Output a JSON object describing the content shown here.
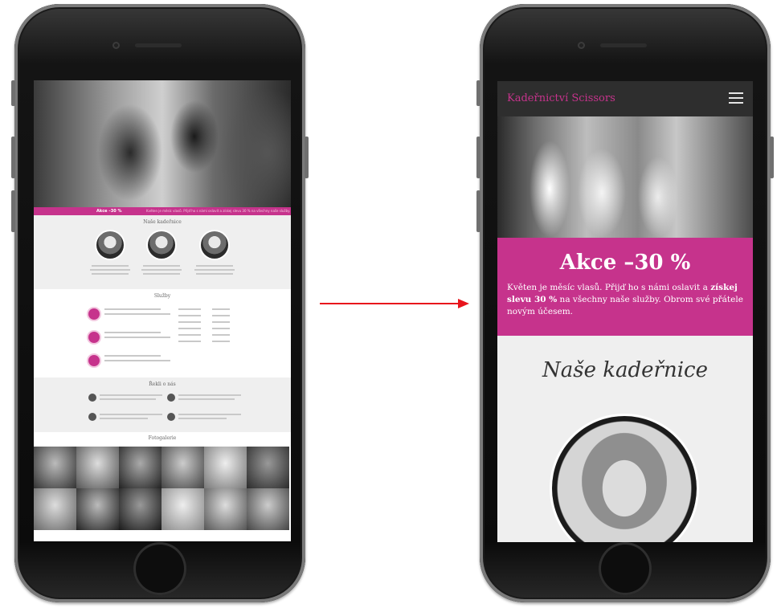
{
  "left_phone": {
    "promo_band": {
      "title": "Akce –30 %",
      "text": "Květen je měsíc vlasů. Přijď ho s námi oslavit a získej slevu 30 % na všechny naše služby."
    },
    "sections": {
      "team_title": "Naše kadeřnice",
      "services_title": "Služby",
      "reviews_title": "Řekli o nás",
      "gallery_title": "Fotogalerie"
    }
  },
  "right_phone": {
    "nav": {
      "brand": "Kadeřnictví Scissors",
      "menu_icon": "hamburger-icon"
    },
    "promo": {
      "title": "Akce –30 %",
      "text_1": "Květen je měsíc vlasů. Přijď ho s námi oslavit a ",
      "text_bold": "získej slevu 30 %",
      "text_2": " na všechny naše služby. Obrom své přátele novým účesem."
    },
    "team": {
      "title": "Naše kadeřnice"
    }
  },
  "arrow": {
    "color": "#e8141c"
  },
  "colors": {
    "accent": "#c6338c",
    "nav_bg": "#2e2e2e",
    "section_bg": "#efefef"
  }
}
